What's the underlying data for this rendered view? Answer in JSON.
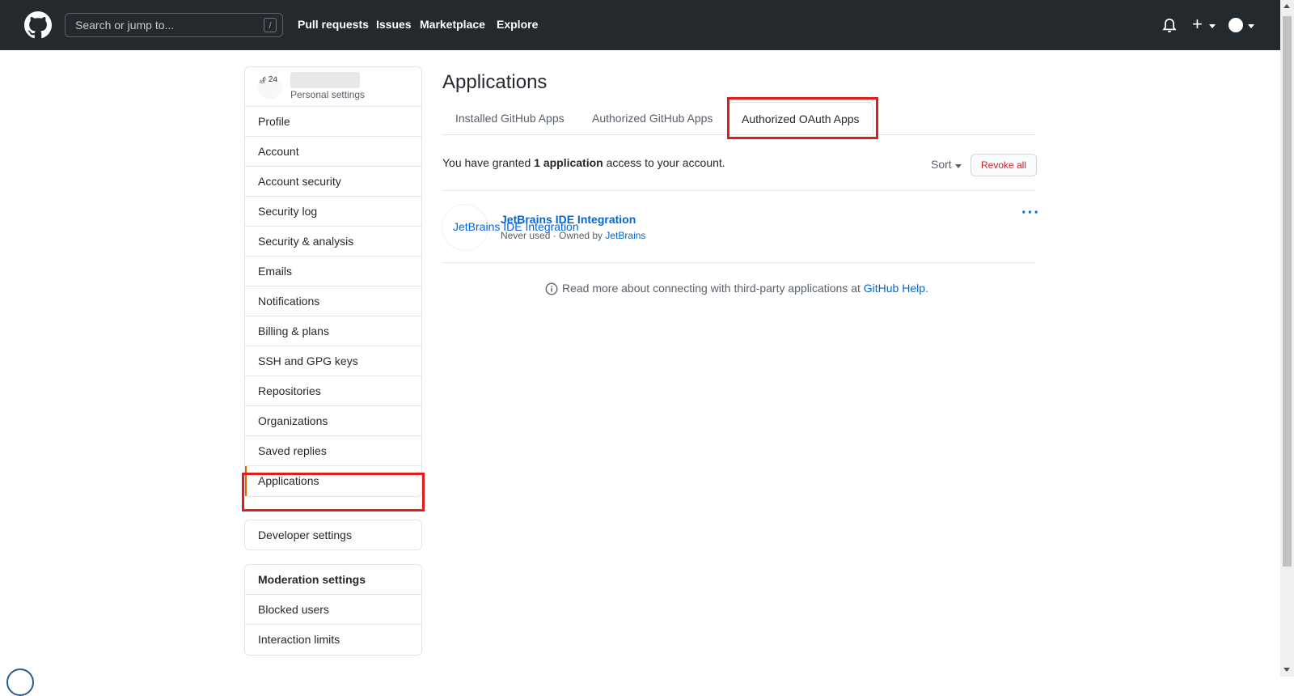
{
  "header": {
    "search_placeholder": "Search or jump to...",
    "search_shortcut": "/",
    "nav": [
      "Pull requests",
      "Issues",
      "Marketplace",
      "Explore"
    ],
    "plus_symbol": "+"
  },
  "sidebar": {
    "avatar_alt": "@ 24",
    "subtitle": "Personal settings",
    "items": [
      {
        "label": "Profile"
      },
      {
        "label": "Account"
      },
      {
        "label": "Account security"
      },
      {
        "label": "Security log"
      },
      {
        "label": "Security & analysis"
      },
      {
        "label": "Emails"
      },
      {
        "label": "Notifications"
      },
      {
        "label": "Billing & plans"
      },
      {
        "label": "SSH and GPG keys"
      },
      {
        "label": "Repositories"
      },
      {
        "label": "Organizations"
      },
      {
        "label": "Saved replies"
      },
      {
        "label": "Applications"
      }
    ],
    "developer_settings": "Developer settings",
    "moderation": {
      "heading": "Moderation settings",
      "items": [
        "Blocked users",
        "Interaction limits"
      ]
    }
  },
  "main": {
    "title": "Applications",
    "tabs": [
      {
        "label": "Installed GitHub Apps"
      },
      {
        "label": "Authorized GitHub Apps"
      },
      {
        "label": "Authorized OAuth Apps"
      }
    ],
    "granted": {
      "prefix": "You have granted ",
      "count": "1 application",
      "suffix": " access to your account."
    },
    "sort_label": "Sort",
    "revoke_label": "Revoke all",
    "app": {
      "avatar_alt": "JetBrains IDE Integration",
      "name": "JetBrains IDE Integration",
      "usage": "Never used · Owned by ",
      "owner": "JetBrains",
      "menu": "···"
    },
    "help": {
      "text": "Read more about connecting with third-party applications at ",
      "link": "GitHub Help",
      "end": "."
    }
  },
  "colors": {
    "header_bg": "#24292e",
    "link": "#0366d6",
    "danger": "#cb2431",
    "highlight_box": "#e31b1b"
  }
}
